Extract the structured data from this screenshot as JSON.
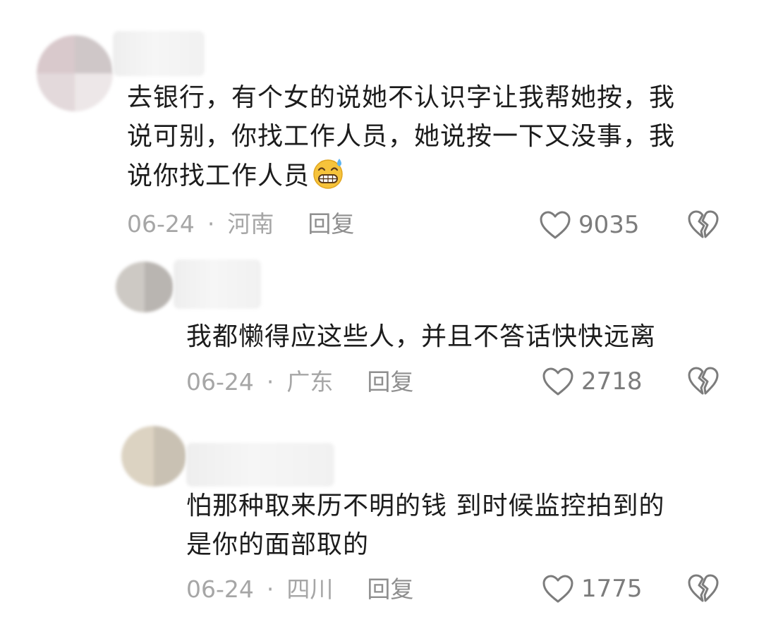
{
  "comments": [
    {
      "text_lines": [
        "去银行，有个女的说她不认识字让我帮她按，我",
        "说可别，你找工作人员，她说按一下又没事，我",
        "说你找工作人员"
      ],
      "emoji": "grinning-sweat-emoji",
      "date": "06-24",
      "separator": "·",
      "location": "河南",
      "reply_label": "回复",
      "likes": "9035"
    },
    {
      "text_lines": [
        "我都懒得应这些人，并且不答话快快远离"
      ],
      "date": "06-24",
      "separator": "·",
      "location": "广东",
      "reply_label": "回复",
      "likes": "2718"
    },
    {
      "text_lines": [
        "怕那种取来历不明的钱 到时候监控拍到的",
        "是你的面部取的"
      ],
      "date": "06-24",
      "separator": "·",
      "location": "四川",
      "reply_label": "回复",
      "likes": "1775"
    }
  ],
  "icons": {
    "like": "heart-outline-icon",
    "dislike": "broken-heart-icon"
  },
  "colors": {
    "text": "#1c1c1c",
    "meta": "#a6a6a6",
    "icon": "#7c7c7c",
    "emoji_face": "#f6c33b",
    "emoji_sweat": "#5fb4f0"
  }
}
